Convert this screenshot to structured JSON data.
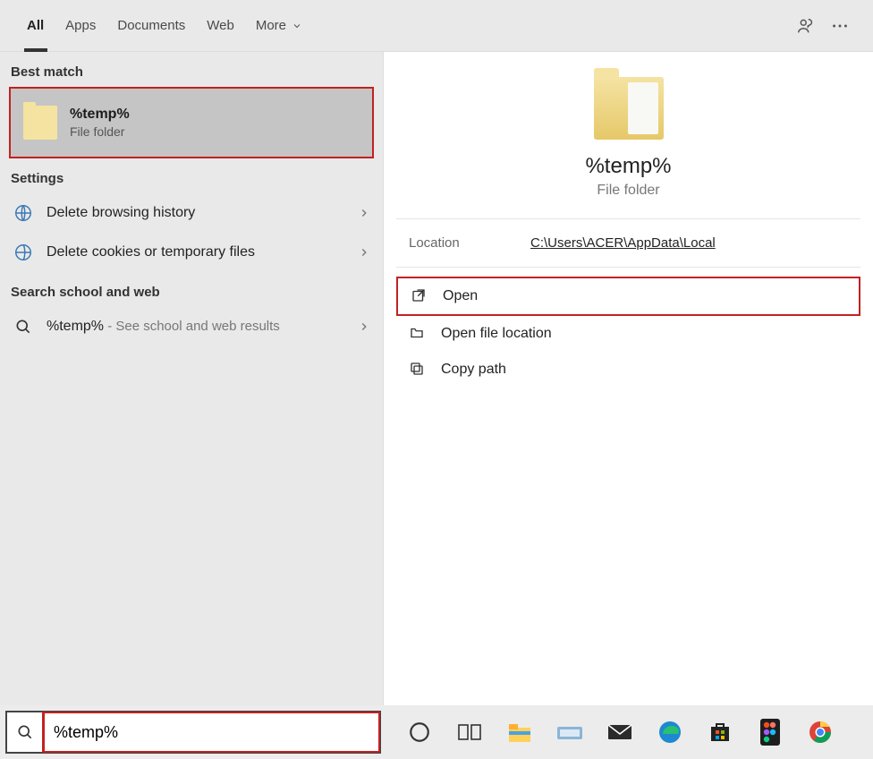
{
  "tabs": {
    "all": "All",
    "apps": "Apps",
    "documents": "Documents",
    "web": "Web",
    "more": "More"
  },
  "left": {
    "best_match_header": "Best match",
    "best_match": {
      "title": "%temp%",
      "subtitle": "File folder"
    },
    "settings_header": "Settings",
    "settings": [
      {
        "label": "Delete browsing history"
      },
      {
        "label": "Delete cookies or temporary files"
      }
    ],
    "search_web_header": "Search school and web",
    "web_result": {
      "query": "%temp%",
      "suffix": " - See school and web results"
    }
  },
  "right": {
    "title": "%temp%",
    "subtitle": "File folder",
    "location_label": "Location",
    "location_value": "C:\\Users\\ACER\\AppData\\Local",
    "actions": {
      "open": "Open",
      "open_location": "Open file location",
      "copy_path": "Copy path"
    }
  },
  "taskbar": {
    "search_value": "%temp%"
  }
}
